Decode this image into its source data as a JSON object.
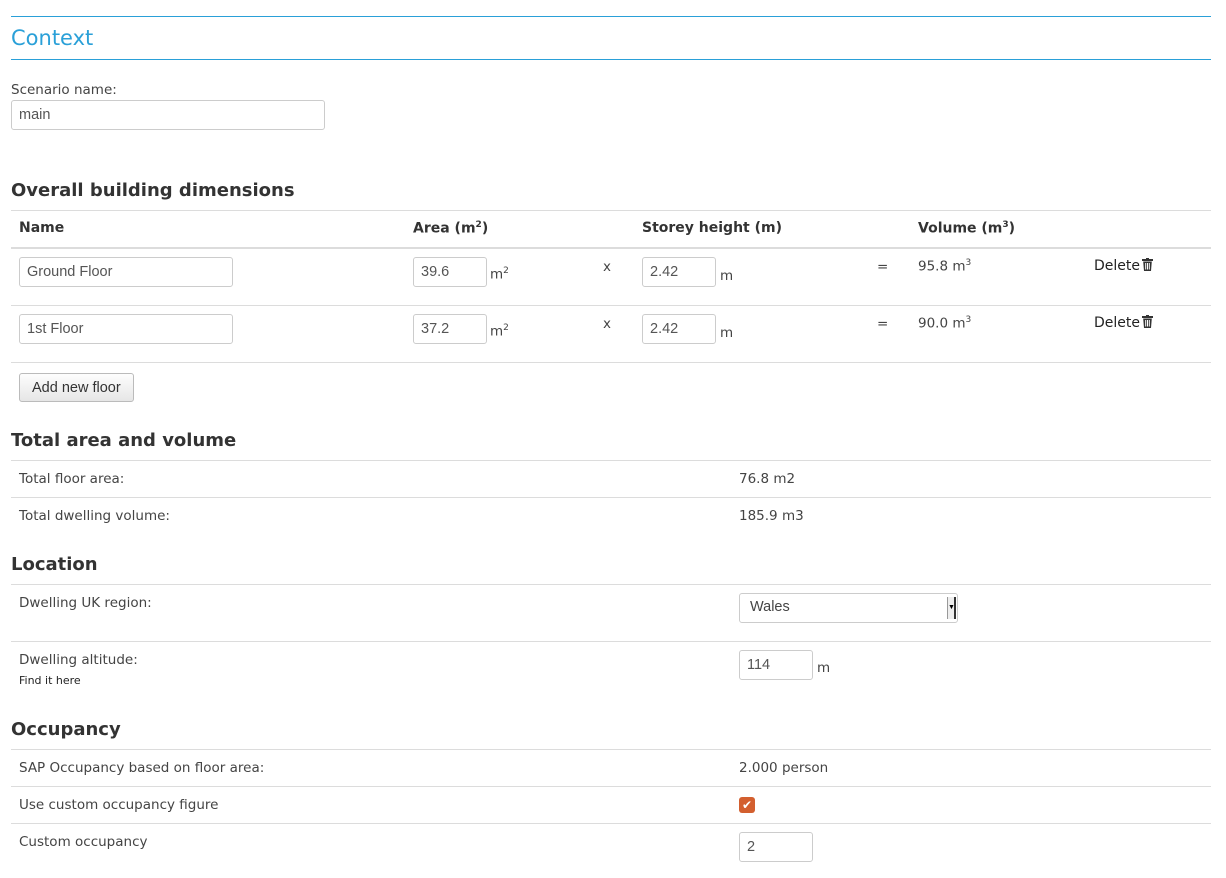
{
  "context": {
    "title": "Context",
    "scenario_label": "Scenario name:",
    "scenario_value": "main"
  },
  "dimensions": {
    "title": "Overall building dimensions",
    "headers": {
      "name": "Name",
      "area": "Area (m",
      "area_sup": "2",
      "height": "Storey height (m)",
      "volume": "Volume (m",
      "volume_sup": "3",
      "close": ")"
    },
    "floors": [
      {
        "name": "Ground Floor",
        "area": "39.6",
        "height": "2.42",
        "volume": "95.8"
      },
      {
        "name": "1st Floor",
        "area": "37.2",
        "height": "2.42",
        "volume": "90.0"
      }
    ],
    "area_unit": "m",
    "area_unit_sup": "2",
    "height_unit": "m",
    "volume_unit": "m",
    "volume_unit_sup": "3",
    "times_symbol": "x",
    "equals_symbol": "=",
    "delete_label": "Delete",
    "add_floor_label": "Add new floor"
  },
  "totals": {
    "title": "Total area and volume",
    "floor_area_label": "Total floor area:",
    "floor_area_value": "76.8 m2",
    "volume_label": "Total dwelling volume:",
    "volume_value": "185.9 m3"
  },
  "location": {
    "title": "Location",
    "region_label": "Dwelling UK region:",
    "region_value": "Wales",
    "altitude_label": "Dwelling altitude:",
    "find_link": "Find it here",
    "altitude_value": "114",
    "altitude_unit": "m"
  },
  "occupancy": {
    "title": "Occupancy",
    "sap_label": "SAP Occupancy based on floor area:",
    "sap_value": "2.000 person",
    "custom_toggle_label": "Use custom occupancy figure",
    "custom_toggle_checked": true,
    "custom_label": "Custom occupancy",
    "custom_value": "2"
  },
  "icons": {
    "delete": "trash-icon",
    "checkbox": "checkmark-icon"
  },
  "colors": {
    "accent": "#2aa0d8",
    "checkbox": "#d35f2f"
  }
}
